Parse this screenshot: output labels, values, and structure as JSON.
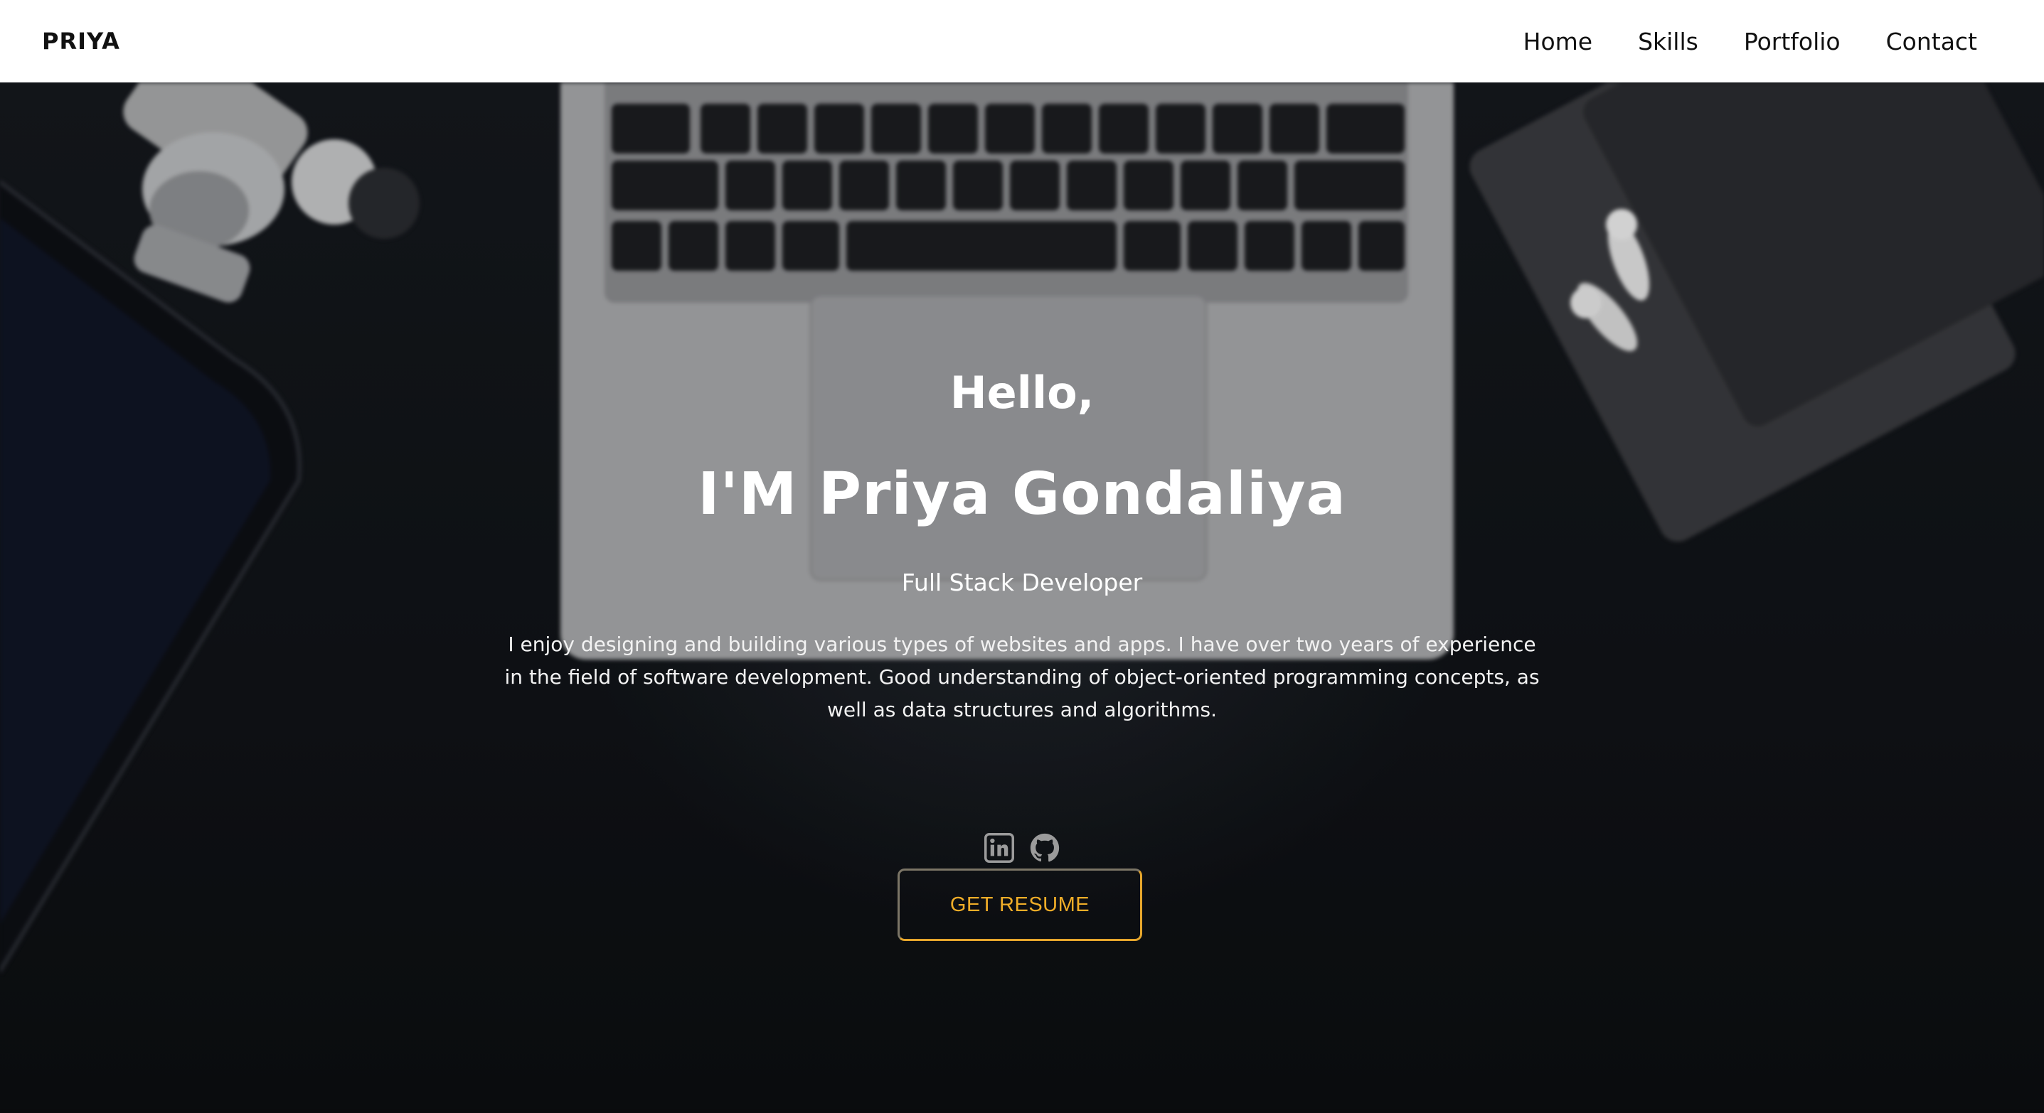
{
  "navbar": {
    "brand": "PRIYA",
    "links": [
      {
        "label": "Home"
      },
      {
        "label": "Skills"
      },
      {
        "label": "Portfolio"
      },
      {
        "label": "Contact"
      }
    ]
  },
  "hero": {
    "greeting": "Hello,",
    "name": "I'M Priya Gondaliya",
    "role": "Full Stack Developer",
    "description": "I enjoy designing and building various types of websites and apps. I have over two years of experience in the field of software development. Good understanding of object-oriented programming concepts, as well as data structures and algorithms.",
    "socials": [
      {
        "icon": "linkedin-icon"
      },
      {
        "icon": "github-icon"
      }
    ],
    "cta_label": "GET RESUME",
    "cta_color": "#f0ad28"
  }
}
